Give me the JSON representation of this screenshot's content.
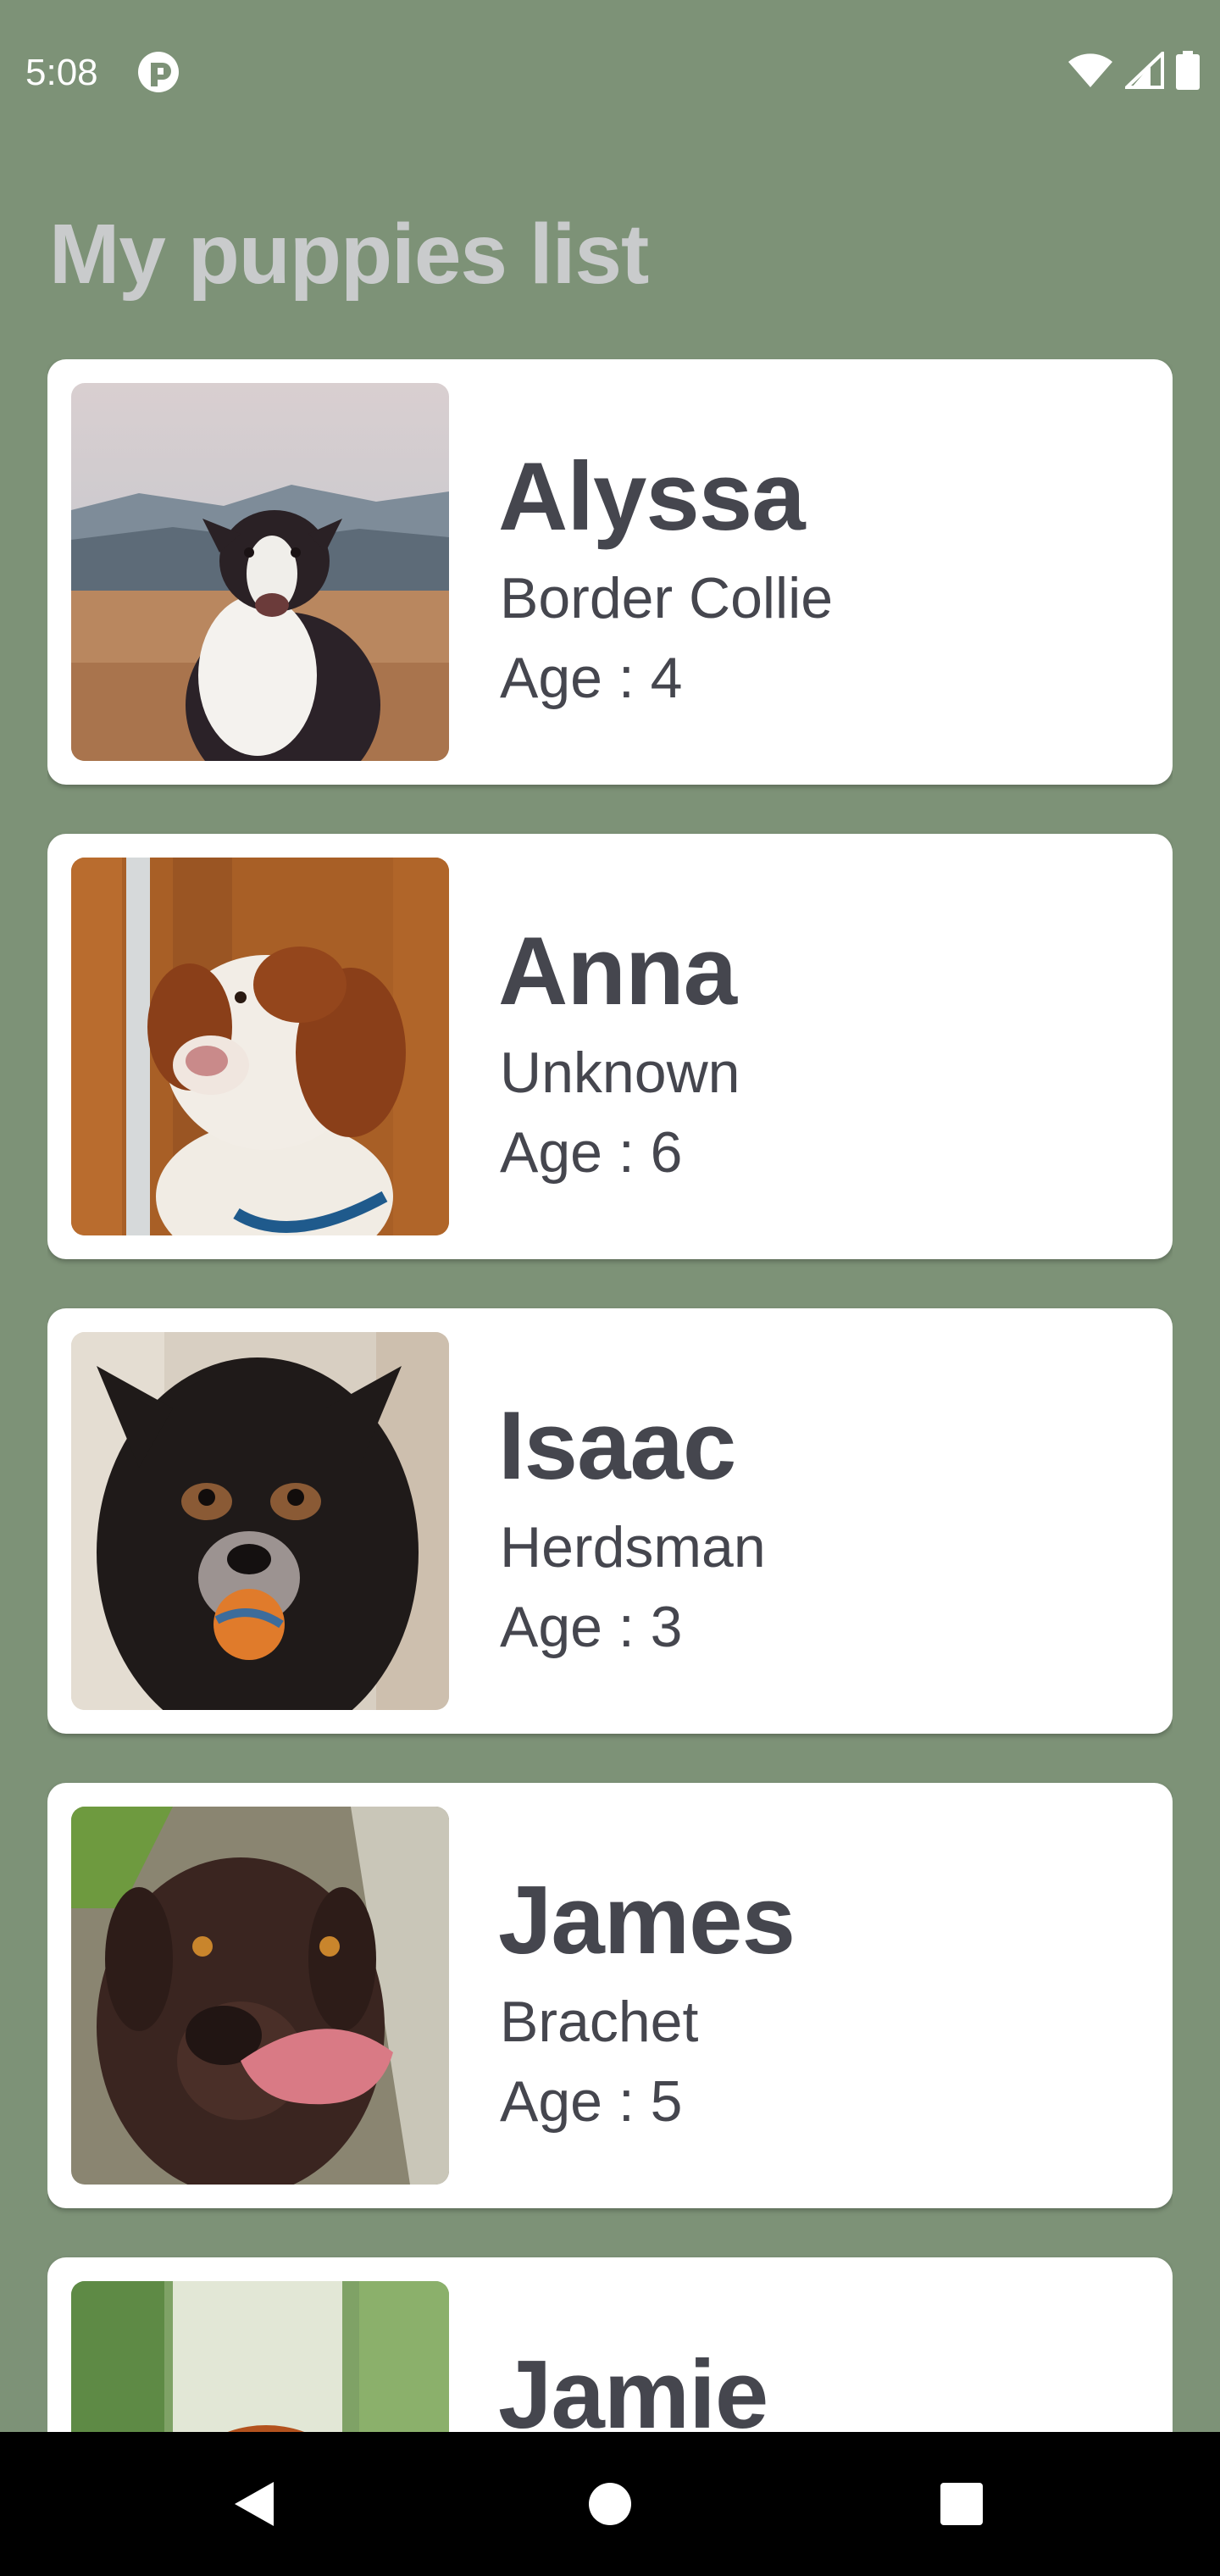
{
  "status_bar": {
    "time": "5:08",
    "app_icon": "app-notification-icon",
    "icons": [
      "wifi-icon",
      "signal-icon",
      "battery-icon"
    ]
  },
  "page": {
    "title": "My puppies list"
  },
  "puppies": [
    {
      "name": "Alyssa",
      "breed": "Border Collie",
      "age": "Age : 4",
      "photo": "border-collie-photo"
    },
    {
      "name": "Anna",
      "breed": "Unknown",
      "age": "Age : 6",
      "photo": "brown-white-dog-photo"
    },
    {
      "name": "Isaac",
      "breed": "Herdsman",
      "age": "Age : 3",
      "photo": "black-dog-ball-photo"
    },
    {
      "name": "James",
      "breed": "Brachet",
      "age": "Age : 5",
      "photo": "chocolate-dog-tongue-photo"
    },
    {
      "name": "Jamie",
      "breed": "",
      "age": "",
      "photo": "red-dog-grass-photo"
    }
  ],
  "nav_bar": {
    "icons": [
      "back-icon",
      "home-icon",
      "recents-icon"
    ]
  },
  "colors": {
    "background": "#7d9277",
    "card": "#ffffff",
    "text": "#45464e",
    "title": "#c9cbcc"
  }
}
